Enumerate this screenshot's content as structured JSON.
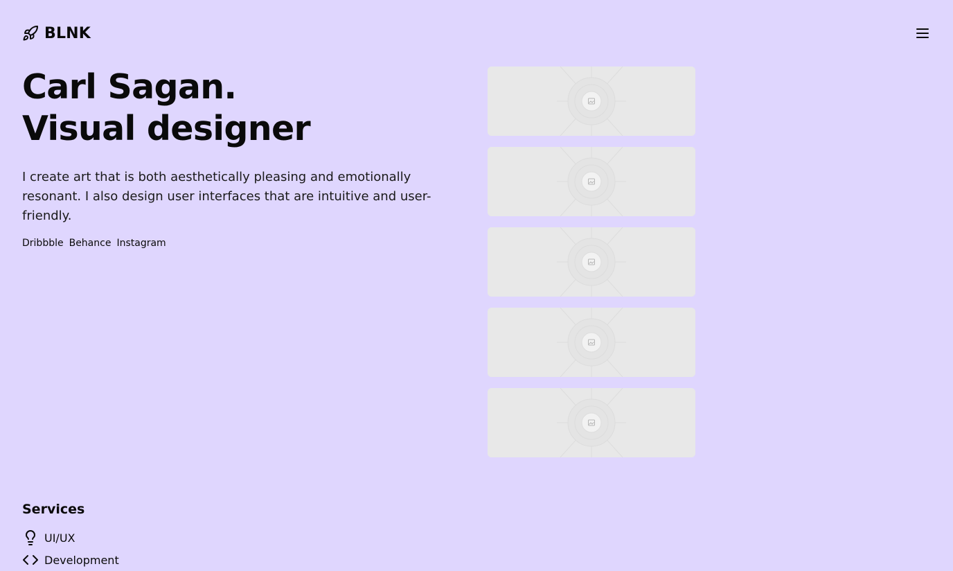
{
  "header": {
    "brand_name": "BLNK",
    "brand_icon": "rocket-icon",
    "menu_icon": "hamburger-menu-icon"
  },
  "hero": {
    "title_line1": "Carl Sagan.",
    "title_line2": "Visual designer",
    "description": "I create art that is both aesthetically pleasing and emotionally resonant. I also design user interfaces that are intuitive and user-friendly.",
    "social_links": [
      "Dribbble",
      "Behance",
      "Instagram"
    ]
  },
  "gallery": {
    "placeholder_icon": "image-placeholder-icon",
    "items": [
      {
        "name": "gallery-image-1"
      },
      {
        "name": "gallery-image-2"
      },
      {
        "name": "gallery-image-3"
      },
      {
        "name": "gallery-image-4"
      },
      {
        "name": "gallery-image-5"
      }
    ]
  },
  "services": {
    "title": "Services",
    "items": [
      {
        "label": "UI/UX",
        "icon": "lightbulb-icon"
      },
      {
        "label": "Development",
        "icon": "code-icon"
      }
    ]
  },
  "colors": {
    "background": "#dfd6fe",
    "text": "#0a0a0a",
    "placeholder_bg": "#e8e8e8"
  }
}
